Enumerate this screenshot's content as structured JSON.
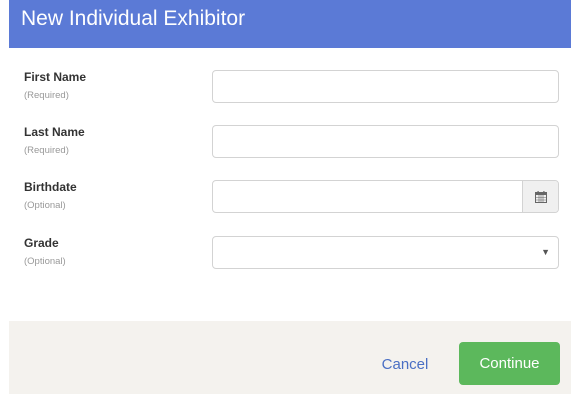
{
  "dialog": {
    "title": "New Individual Exhibitor"
  },
  "fields": {
    "first_name": {
      "label": "First Name",
      "hint": "(Required)",
      "value": "",
      "placeholder": ""
    },
    "last_name": {
      "label": "Last Name",
      "hint": "(Required)",
      "value": "",
      "placeholder": ""
    },
    "birthdate": {
      "label": "Birthdate",
      "hint": "(Optional)",
      "value": "",
      "placeholder": "",
      "icon": "calendar-icon"
    },
    "grade": {
      "label": "Grade",
      "hint": "(Optional)",
      "selected": "",
      "icon": "caret-down-icon"
    }
  },
  "footer": {
    "cancel_label": "Cancel",
    "continue_label": "Continue"
  },
  "colors": {
    "header_bg": "#5b7ad6",
    "primary_button": "#5cb85c",
    "link": "#4a6fc4",
    "footer_bg": "#f4f2ee"
  }
}
